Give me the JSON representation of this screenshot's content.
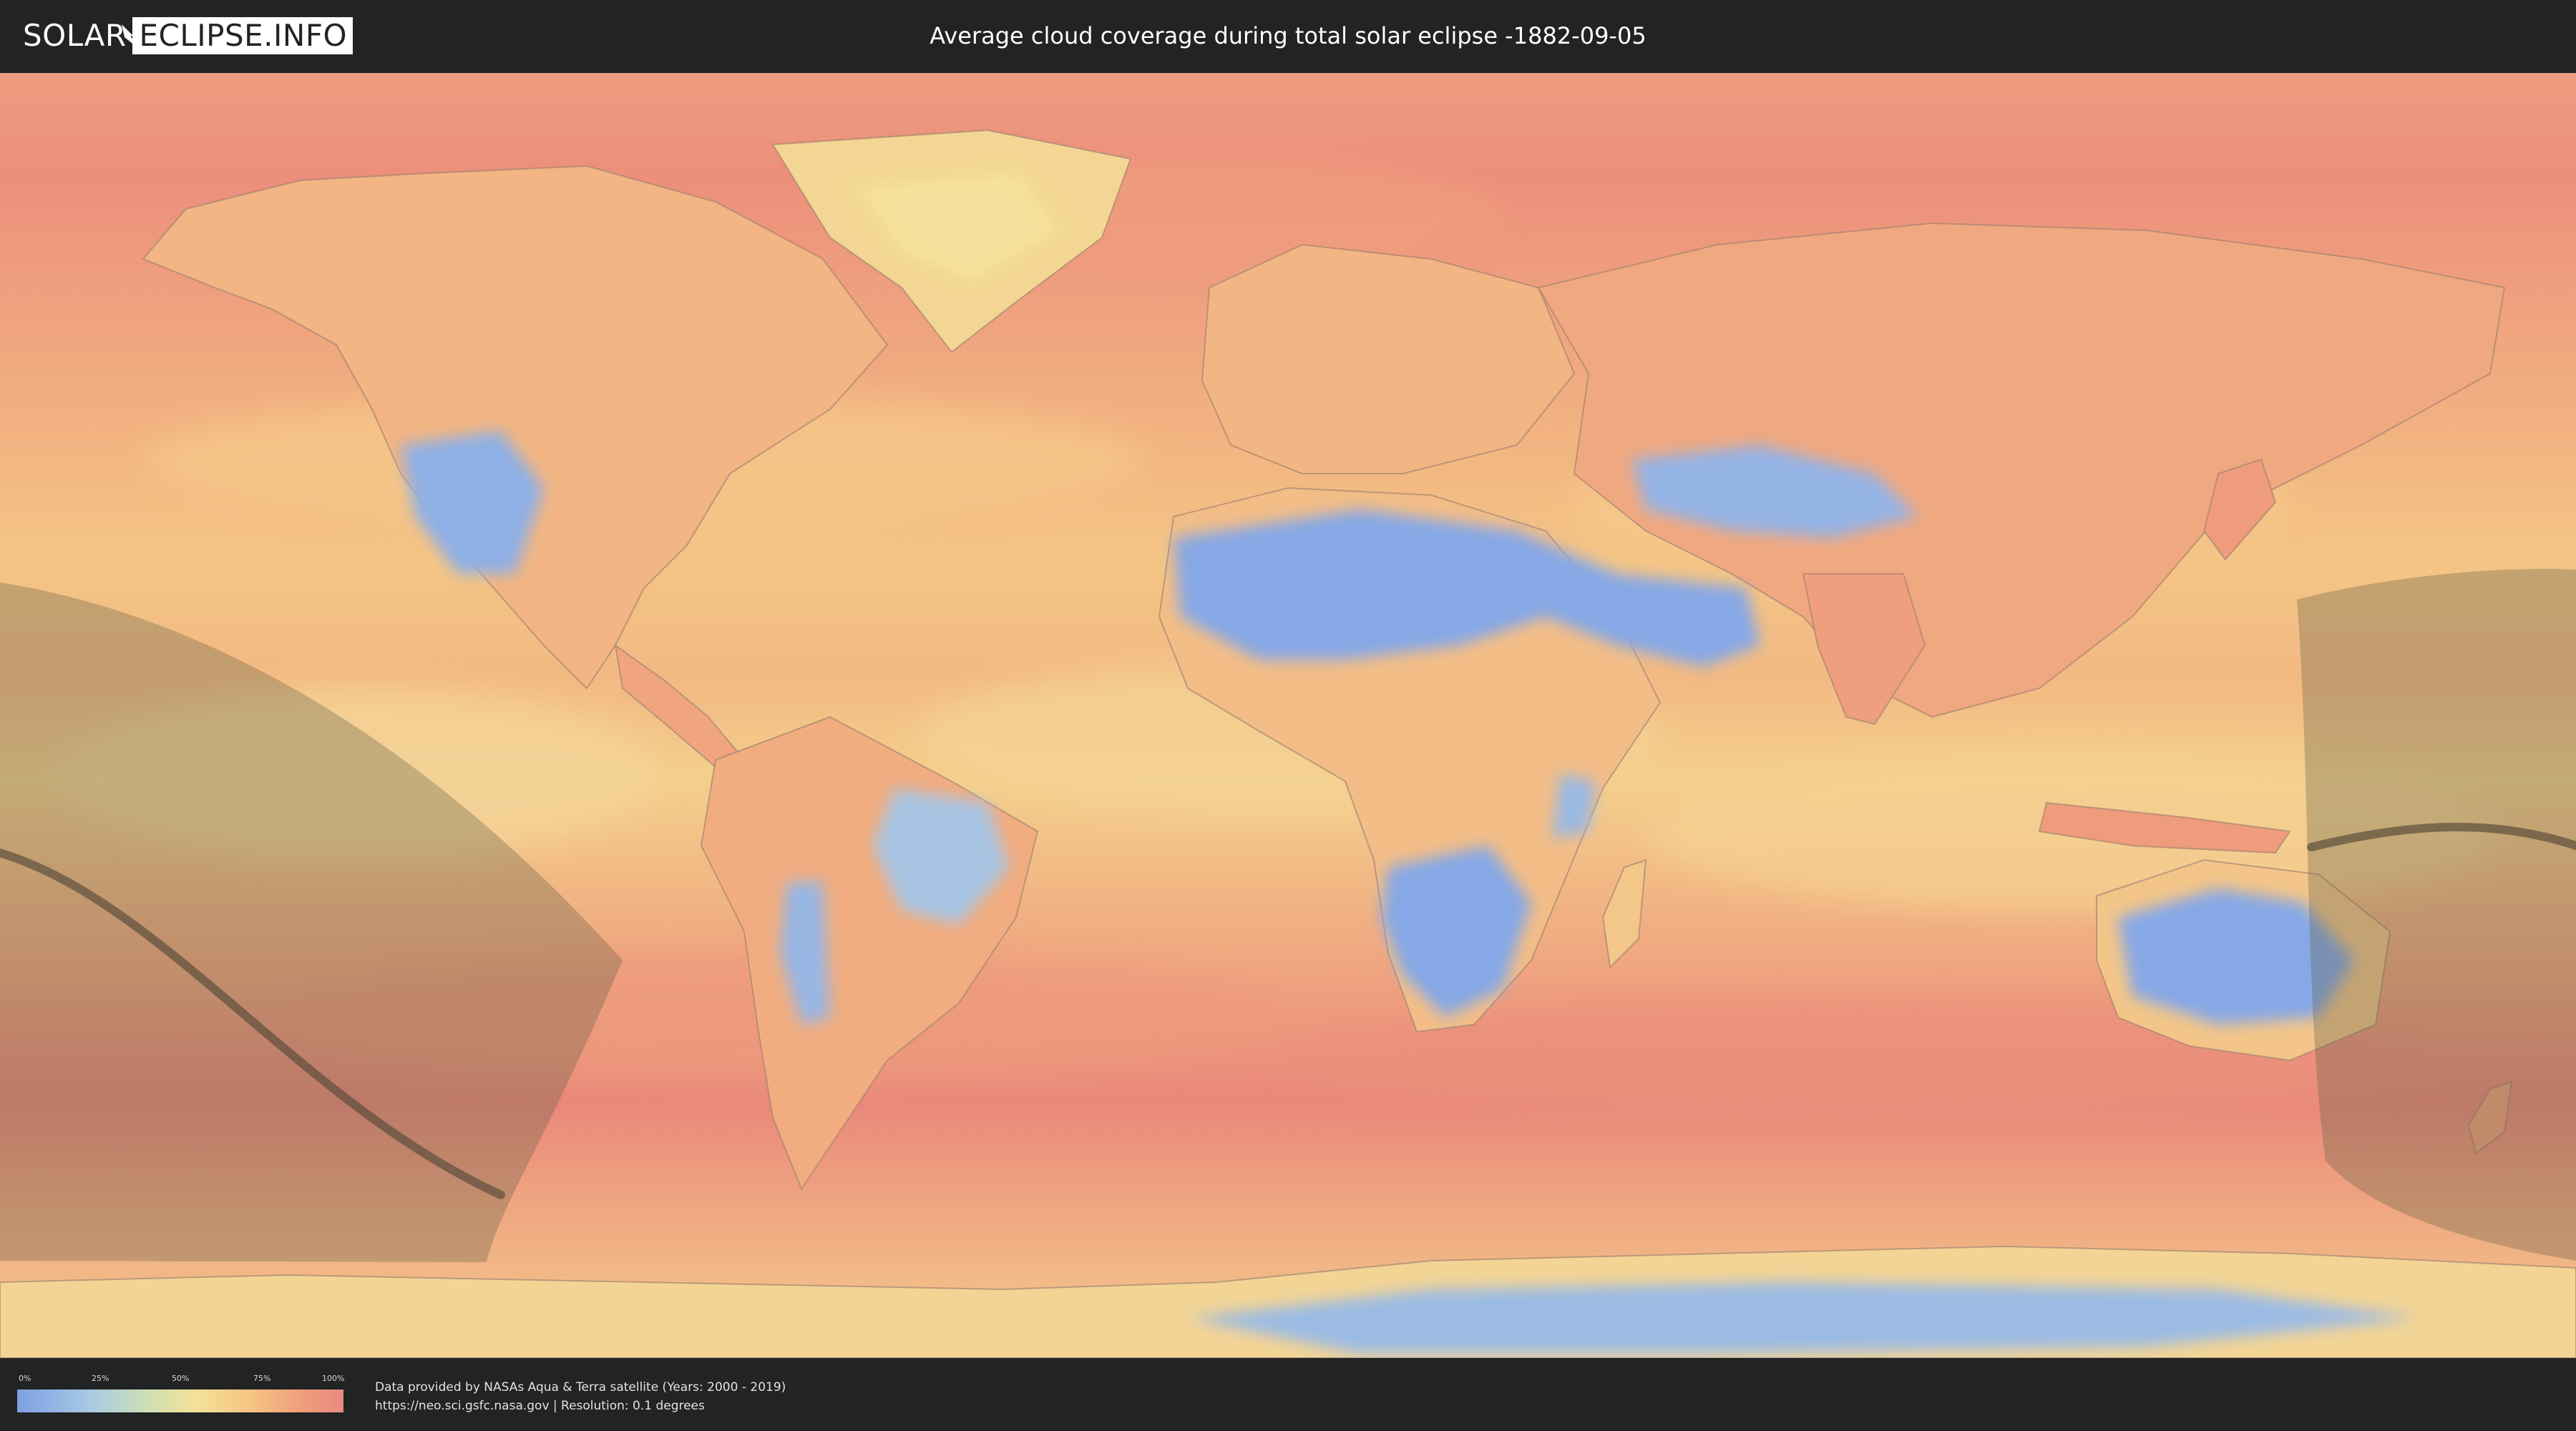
{
  "header": {
    "logo_left": "SOLAR",
    "logo_right": "ECLIPSE.INFO",
    "title": "Average cloud coverage during total solar eclipse -1882-09-05"
  },
  "map": {
    "icon": "world-cloud-coverage-map",
    "colors": {
      "ocean_cloudy": "#ec8f7c",
      "ocean_mid": "#f4c184",
      "clear_sky": "#85a7e6",
      "partly": "#f3dc9a",
      "eclipse_shade": "#5e5b45",
      "central_line": "#5a4e3c",
      "coastline": "#9a7e6a"
    }
  },
  "legend": {
    "ticks": [
      "0%",
      "25%",
      "50%",
      "75%",
      "100%"
    ],
    "gradient_stops": [
      {
        "at": 0,
        "color": "#7f9fe4"
      },
      {
        "at": 0.25,
        "color": "#a6c9e4"
      },
      {
        "at": 0.5,
        "color": "#f4e196"
      },
      {
        "at": 0.75,
        "color": "#f6c383"
      },
      {
        "at": 1,
        "color": "#ea8a82"
      }
    ]
  },
  "footer": {
    "credit_line1": "Data provided by NASAs Aqua & Terra satellite (Years: 2000 - 2019)",
    "credit_line2": "https://neo.sci.gsfc.nasa.gov | Resolution: 0.1 degrees"
  }
}
